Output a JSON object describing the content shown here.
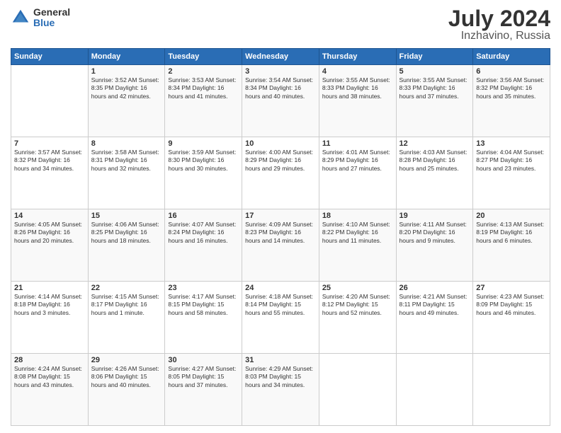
{
  "logo": {
    "general": "General",
    "blue": "Blue"
  },
  "title": {
    "month_year": "July 2024",
    "location": "Inzhavino, Russia"
  },
  "days_of_week": [
    "Sunday",
    "Monday",
    "Tuesday",
    "Wednesday",
    "Thursday",
    "Friday",
    "Saturday"
  ],
  "weeks": [
    [
      {
        "day": "",
        "info": ""
      },
      {
        "day": "1",
        "info": "Sunrise: 3:52 AM\nSunset: 8:35 PM\nDaylight: 16 hours\nand 42 minutes."
      },
      {
        "day": "2",
        "info": "Sunrise: 3:53 AM\nSunset: 8:34 PM\nDaylight: 16 hours\nand 41 minutes."
      },
      {
        "day": "3",
        "info": "Sunrise: 3:54 AM\nSunset: 8:34 PM\nDaylight: 16 hours\nand 40 minutes."
      },
      {
        "day": "4",
        "info": "Sunrise: 3:55 AM\nSunset: 8:33 PM\nDaylight: 16 hours\nand 38 minutes."
      },
      {
        "day": "5",
        "info": "Sunrise: 3:55 AM\nSunset: 8:33 PM\nDaylight: 16 hours\nand 37 minutes."
      },
      {
        "day": "6",
        "info": "Sunrise: 3:56 AM\nSunset: 8:32 PM\nDaylight: 16 hours\nand 35 minutes."
      }
    ],
    [
      {
        "day": "7",
        "info": "Sunrise: 3:57 AM\nSunset: 8:32 PM\nDaylight: 16 hours\nand 34 minutes."
      },
      {
        "day": "8",
        "info": "Sunrise: 3:58 AM\nSunset: 8:31 PM\nDaylight: 16 hours\nand 32 minutes."
      },
      {
        "day": "9",
        "info": "Sunrise: 3:59 AM\nSunset: 8:30 PM\nDaylight: 16 hours\nand 30 minutes."
      },
      {
        "day": "10",
        "info": "Sunrise: 4:00 AM\nSunset: 8:29 PM\nDaylight: 16 hours\nand 29 minutes."
      },
      {
        "day": "11",
        "info": "Sunrise: 4:01 AM\nSunset: 8:29 PM\nDaylight: 16 hours\nand 27 minutes."
      },
      {
        "day": "12",
        "info": "Sunrise: 4:03 AM\nSunset: 8:28 PM\nDaylight: 16 hours\nand 25 minutes."
      },
      {
        "day": "13",
        "info": "Sunrise: 4:04 AM\nSunset: 8:27 PM\nDaylight: 16 hours\nand 23 minutes."
      }
    ],
    [
      {
        "day": "14",
        "info": "Sunrise: 4:05 AM\nSunset: 8:26 PM\nDaylight: 16 hours\nand 20 minutes."
      },
      {
        "day": "15",
        "info": "Sunrise: 4:06 AM\nSunset: 8:25 PM\nDaylight: 16 hours\nand 18 minutes."
      },
      {
        "day": "16",
        "info": "Sunrise: 4:07 AM\nSunset: 8:24 PM\nDaylight: 16 hours\nand 16 minutes."
      },
      {
        "day": "17",
        "info": "Sunrise: 4:09 AM\nSunset: 8:23 PM\nDaylight: 16 hours\nand 14 minutes."
      },
      {
        "day": "18",
        "info": "Sunrise: 4:10 AM\nSunset: 8:22 PM\nDaylight: 16 hours\nand 11 minutes."
      },
      {
        "day": "19",
        "info": "Sunrise: 4:11 AM\nSunset: 8:20 PM\nDaylight: 16 hours\nand 9 minutes."
      },
      {
        "day": "20",
        "info": "Sunrise: 4:13 AM\nSunset: 8:19 PM\nDaylight: 16 hours\nand 6 minutes."
      }
    ],
    [
      {
        "day": "21",
        "info": "Sunrise: 4:14 AM\nSunset: 8:18 PM\nDaylight: 16 hours\nand 3 minutes."
      },
      {
        "day": "22",
        "info": "Sunrise: 4:15 AM\nSunset: 8:17 PM\nDaylight: 16 hours\nand 1 minute."
      },
      {
        "day": "23",
        "info": "Sunrise: 4:17 AM\nSunset: 8:15 PM\nDaylight: 15 hours\nand 58 minutes."
      },
      {
        "day": "24",
        "info": "Sunrise: 4:18 AM\nSunset: 8:14 PM\nDaylight: 15 hours\nand 55 minutes."
      },
      {
        "day": "25",
        "info": "Sunrise: 4:20 AM\nSunset: 8:12 PM\nDaylight: 15 hours\nand 52 minutes."
      },
      {
        "day": "26",
        "info": "Sunrise: 4:21 AM\nSunset: 8:11 PM\nDaylight: 15 hours\nand 49 minutes."
      },
      {
        "day": "27",
        "info": "Sunrise: 4:23 AM\nSunset: 8:09 PM\nDaylight: 15 hours\nand 46 minutes."
      }
    ],
    [
      {
        "day": "28",
        "info": "Sunrise: 4:24 AM\nSunset: 8:08 PM\nDaylight: 15 hours\nand 43 minutes."
      },
      {
        "day": "29",
        "info": "Sunrise: 4:26 AM\nSunset: 8:06 PM\nDaylight: 15 hours\nand 40 minutes."
      },
      {
        "day": "30",
        "info": "Sunrise: 4:27 AM\nSunset: 8:05 PM\nDaylight: 15 hours\nand 37 minutes."
      },
      {
        "day": "31",
        "info": "Sunrise: 4:29 AM\nSunset: 8:03 PM\nDaylight: 15 hours\nand 34 minutes."
      },
      {
        "day": "",
        "info": ""
      },
      {
        "day": "",
        "info": ""
      },
      {
        "day": "",
        "info": ""
      }
    ]
  ]
}
